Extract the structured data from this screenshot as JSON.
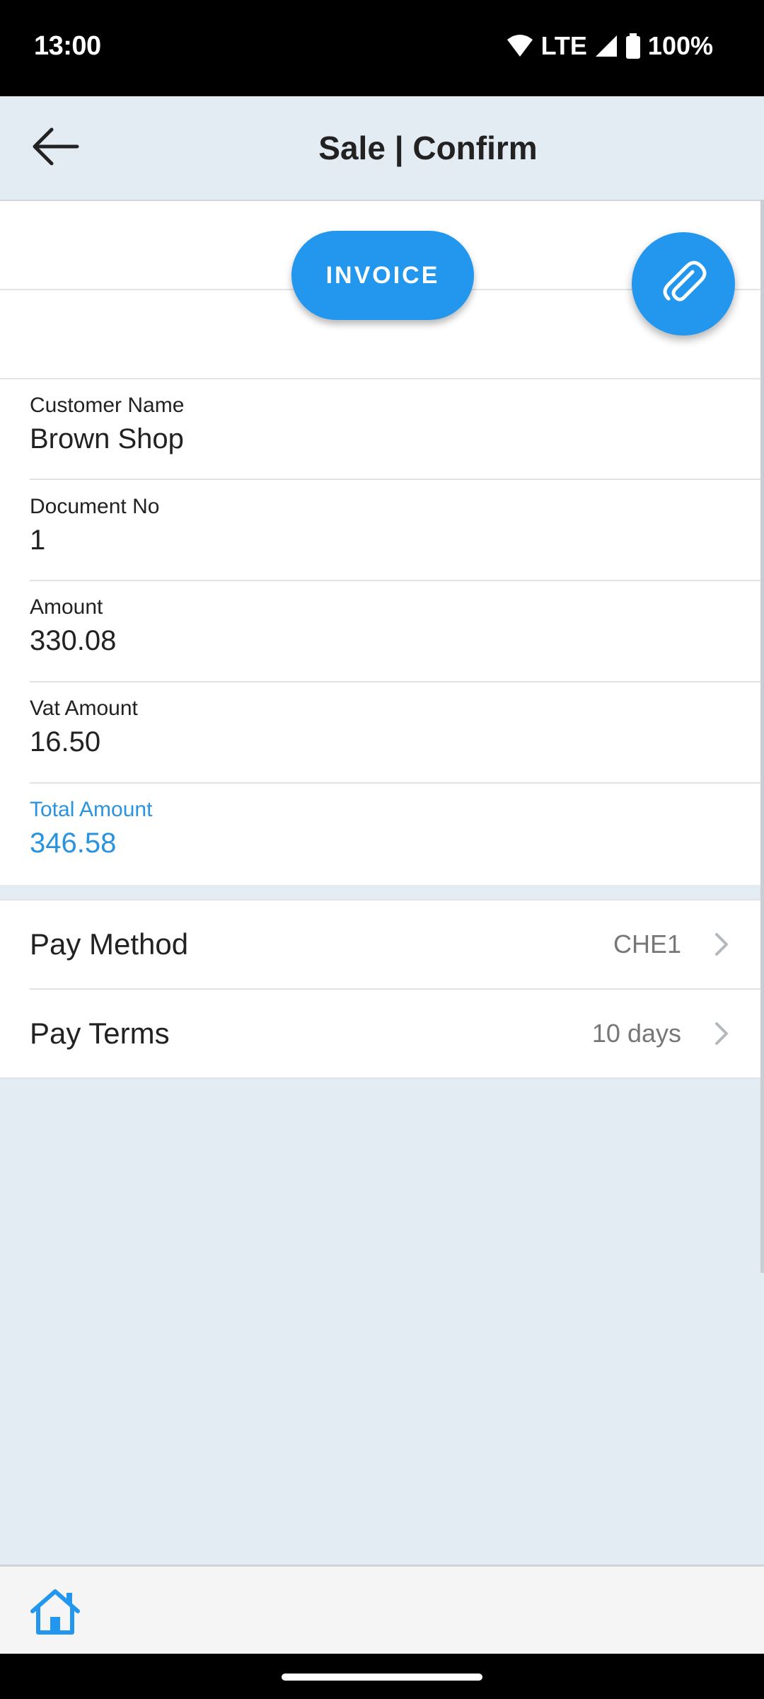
{
  "status_bar": {
    "time": "13:00",
    "network": "LTE",
    "battery": "100%",
    "icons": [
      "wifi-icon",
      "signal-icon",
      "battery-icon"
    ]
  },
  "app_bar": {
    "title": "Sale | Confirm",
    "back_icon": "arrow-left-icon"
  },
  "actions": {
    "invoice_label": "INVOICE",
    "attach_icon": "paperclip-icon"
  },
  "fields": [
    {
      "label": "Customer Name",
      "value": "Brown Shop"
    },
    {
      "label": "Document No",
      "value": "1"
    },
    {
      "label": "Amount",
      "value": "330.08"
    },
    {
      "label": "Vat Amount",
      "value": "16.50"
    },
    {
      "label": "Total Amount",
      "value": "346.58"
    }
  ],
  "payment": {
    "method_label": "Pay Method",
    "method_value": "CHE1",
    "terms_label": "Pay Terms",
    "terms_value": "10 days"
  },
  "bottom_nav": {
    "home_icon": "home-icon"
  },
  "colors": {
    "accent": "#2397ee",
    "background": "#e3ebf3",
    "total_text": "#2a93e0"
  }
}
